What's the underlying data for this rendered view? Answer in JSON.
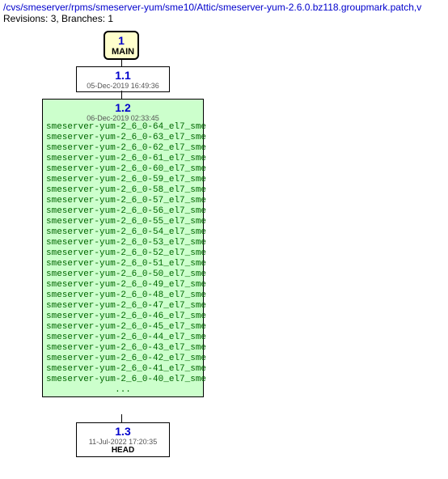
{
  "header": {
    "path": "/cvs/smeserver/rpms/smeserver-yum/sme10/Attic/smeserver-yum-2.6.0.bz118.groupmark.patch,v",
    "revisions": "Revisions: 3, Branches: 1"
  },
  "main_branch": {
    "number": "1",
    "label": "MAIN"
  },
  "rev_1_1": {
    "version": "1.1",
    "date": "05-Dec-2019 16:49:36"
  },
  "rev_1_2": {
    "version": "1.2",
    "date": "06-Dec-2019 02:33:45",
    "tags": [
      "smeserver-yum-2_6_0-64_el7_sme",
      "smeserver-yum-2_6_0-63_el7_sme",
      "smeserver-yum-2_6_0-62_el7_sme",
      "smeserver-yum-2_6_0-61_el7_sme",
      "smeserver-yum-2_6_0-60_el7_sme",
      "smeserver-yum-2_6_0-59_el7_sme",
      "smeserver-yum-2_6_0-58_el7_sme",
      "smeserver-yum-2_6_0-57_el7_sme",
      "smeserver-yum-2_6_0-56_el7_sme",
      "smeserver-yum-2_6_0-55_el7_sme",
      "smeserver-yum-2_6_0-54_el7_sme",
      "smeserver-yum-2_6_0-53_el7_sme",
      "smeserver-yum-2_6_0-52_el7_sme",
      "smeserver-yum-2_6_0-51_el7_sme",
      "smeserver-yum-2_6_0-50_el7_sme",
      "smeserver-yum-2_6_0-49_el7_sme",
      "smeserver-yum-2_6_0-48_el7_sme",
      "smeserver-yum-2_6_0-47_el7_sme",
      "smeserver-yum-2_6_0-46_el7_sme",
      "smeserver-yum-2_6_0-45_el7_sme",
      "smeserver-yum-2_6_0-44_el7_sme",
      "smeserver-yum-2_6_0-43_el7_sme",
      "smeserver-yum-2_6_0-42_el7_sme",
      "smeserver-yum-2_6_0-41_el7_sme",
      "smeserver-yum-2_6_0-40_el7_sme"
    ],
    "ellipsis": "..."
  },
  "rev_1_3": {
    "version": "1.3",
    "date": "11-Jul-2022 17:20:35",
    "head": "HEAD"
  }
}
